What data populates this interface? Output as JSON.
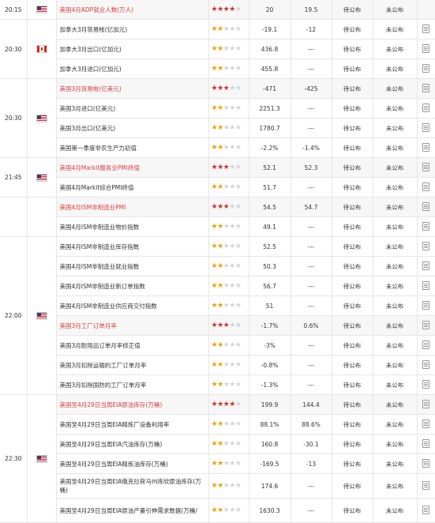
{
  "groups": [
    {
      "time": "20:15",
      "country": "us",
      "rows": [
        {
          "name": "美国4月ADP就业人数(万人)",
          "imp": true,
          "stars": 4,
          "prev": "20",
          "forecast": "19.5",
          "actual": "待公布",
          "impact": "未公布",
          "doc": false
        }
      ]
    },
    {
      "time": "20:30",
      "country": "ca",
      "rows": [
        {
          "name": "加拿大3月贸易帐(亿加元)",
          "imp": false,
          "stars": 2,
          "prev": "-19.1",
          "forecast": "-12",
          "actual": "待公布",
          "impact": "未公布",
          "doc": true
        },
        {
          "name": "加拿大3月出口(亿加元)",
          "imp": false,
          "stars": 2,
          "prev": "436.8",
          "forecast": "---",
          "actual": "待公布",
          "impact": "未公布",
          "doc": true
        },
        {
          "name": "加拿大3月进口(亿加元)",
          "imp": false,
          "stars": 2,
          "prev": "455.8",
          "forecast": "---",
          "actual": "待公布",
          "impact": "未公布",
          "doc": true
        }
      ]
    },
    {
      "time": "20:30",
      "country": "us",
      "rows": [
        {
          "name": "美国3月贸易帐(亿美元)",
          "imp": true,
          "stars": 3,
          "prev": "-471",
          "forecast": "-425",
          "actual": "待公布",
          "impact": "未公布",
          "doc": true
        },
        {
          "name": "美国3月进口(亿美元)",
          "imp": false,
          "stars": 2,
          "prev": "2251.3",
          "forecast": "---",
          "actual": "待公布",
          "impact": "未公布",
          "doc": true
        },
        {
          "name": "美国3月出口(亿美元)",
          "imp": false,
          "stars": 2,
          "prev": "1780.7",
          "forecast": "---",
          "actual": "待公布",
          "impact": "未公布",
          "doc": true
        },
        {
          "name": "美国第一季度非农生产力初值",
          "imp": false,
          "stars": 2,
          "prev": "-2.2%",
          "forecast": "-1.4%",
          "actual": "待公布",
          "impact": "未公布",
          "doc": true
        }
      ]
    },
    {
      "time": "21:45",
      "country": "us",
      "rows": [
        {
          "name": "美国4月Markit服务业PMI终值",
          "imp": true,
          "stars": 3,
          "prev": "52.1",
          "forecast": "52.3",
          "actual": "待公布",
          "impact": "未公布",
          "doc": true
        },
        {
          "name": "美国4月Markit综合PMI终值",
          "imp": false,
          "stars": 2,
          "prev": "51.7",
          "forecast": "---",
          "actual": "待公布",
          "impact": "未公布",
          "doc": true
        }
      ]
    },
    {
      "time": "",
      "country": "",
      "rows": [
        {
          "name": "美国4月ISM非制造业PMI",
          "imp": true,
          "stars": 3,
          "prev": "54.5",
          "forecast": "54.7",
          "actual": "待公布",
          "impact": "未公布",
          "doc": true
        },
        {
          "name": "美国4月ISM非制造业物价指数",
          "imp": false,
          "stars": 2,
          "prev": "49.1",
          "forecast": "---",
          "actual": "待公布",
          "impact": "未公布",
          "doc": true
        }
      ]
    },
    {
      "time": "22:00",
      "country": "us",
      "rows": [
        {
          "name": "美国4月ISM非制造业库存指数",
          "imp": false,
          "stars": 2,
          "prev": "52.5",
          "forecast": "---",
          "actual": "待公布",
          "impact": "未公布",
          "doc": true
        },
        {
          "name": "美国4月ISM非制造业就业指数",
          "imp": false,
          "stars": 2,
          "prev": "50.3",
          "forecast": "---",
          "actual": "待公布",
          "impact": "未公布",
          "doc": true
        },
        {
          "name": "美国4月ISM非制造业新订单指数",
          "imp": false,
          "stars": 2,
          "prev": "56.7",
          "forecast": "---",
          "actual": "待公布",
          "impact": "未公布",
          "doc": true
        },
        {
          "name": "美国4月ISM非制造业供应商交付指数",
          "imp": false,
          "stars": 2,
          "prev": "51",
          "forecast": "---",
          "actual": "待公布",
          "impact": "未公布",
          "doc": true
        },
        {
          "name": "美国3月工厂订单月率",
          "imp": true,
          "stars": 3,
          "prev": "-1.7%",
          "forecast": "0.6%",
          "actual": "待公布",
          "impact": "未公布",
          "doc": true
        },
        {
          "name": "美国3月耐用品订单月率修正值",
          "imp": false,
          "stars": 2,
          "prev": "-3%",
          "forecast": "---",
          "actual": "待公布",
          "impact": "未公布",
          "doc": true
        },
        {
          "name": "美国3月扣除运输的工厂订单月率",
          "imp": false,
          "stars": 2,
          "prev": "-0.8%",
          "forecast": "---",
          "actual": "待公布",
          "impact": "未公布",
          "doc": true
        },
        {
          "name": "美国3月扣除国防的工厂订单月率",
          "imp": false,
          "stars": 2,
          "prev": "-1.3%",
          "forecast": "---",
          "actual": "待公布",
          "impact": "未公布",
          "doc": true
        }
      ]
    },
    {
      "time": "22:30",
      "country": "us",
      "rows": [
        {
          "name": "美国至4月29日当周EIA原油库存(万桶)",
          "imp": true,
          "stars": 4,
          "prev": "199.9",
          "forecast": "144.4",
          "actual": "待公布",
          "impact": "未公布",
          "doc": true
        },
        {
          "name": "美国至4月29日当周EIA精炼厂设备利用率",
          "imp": false,
          "stars": 2,
          "prev": "88.1%",
          "forecast": "88.6%",
          "actual": "待公布",
          "impact": "未公布",
          "doc": true
        },
        {
          "name": "美国至4月29日当周EIA汽油库存(万桶)",
          "imp": false,
          "stars": 2,
          "prev": "160.8",
          "forecast": "-30.1",
          "actual": "待公布",
          "impact": "未公布",
          "doc": true
        },
        {
          "name": "美国至4月29日当周EIA精炼油库存(万桶)",
          "imp": false,
          "stars": 2,
          "prev": "-169.5",
          "forecast": "-13",
          "actual": "待公布",
          "impact": "未公布",
          "doc": true
        },
        {
          "name": "美国至4月29日当周EIA俄克拉荷马州库欣原油库存(万桶)",
          "imp": false,
          "stars": 2,
          "prev": "174.6",
          "forecast": "---",
          "actual": "待公布",
          "impact": "未公布",
          "doc": true,
          "tall": true
        },
        {
          "name": "美国至4月29日当周EIA原油产量引伸需求数据(万桶/",
          "imp": false,
          "stars": 2,
          "prev": "1630.3",
          "forecast": "---",
          "actual": "待公布",
          "impact": "未公布",
          "doc": true,
          "tall": true
        }
      ]
    }
  ],
  "star_total": 5
}
